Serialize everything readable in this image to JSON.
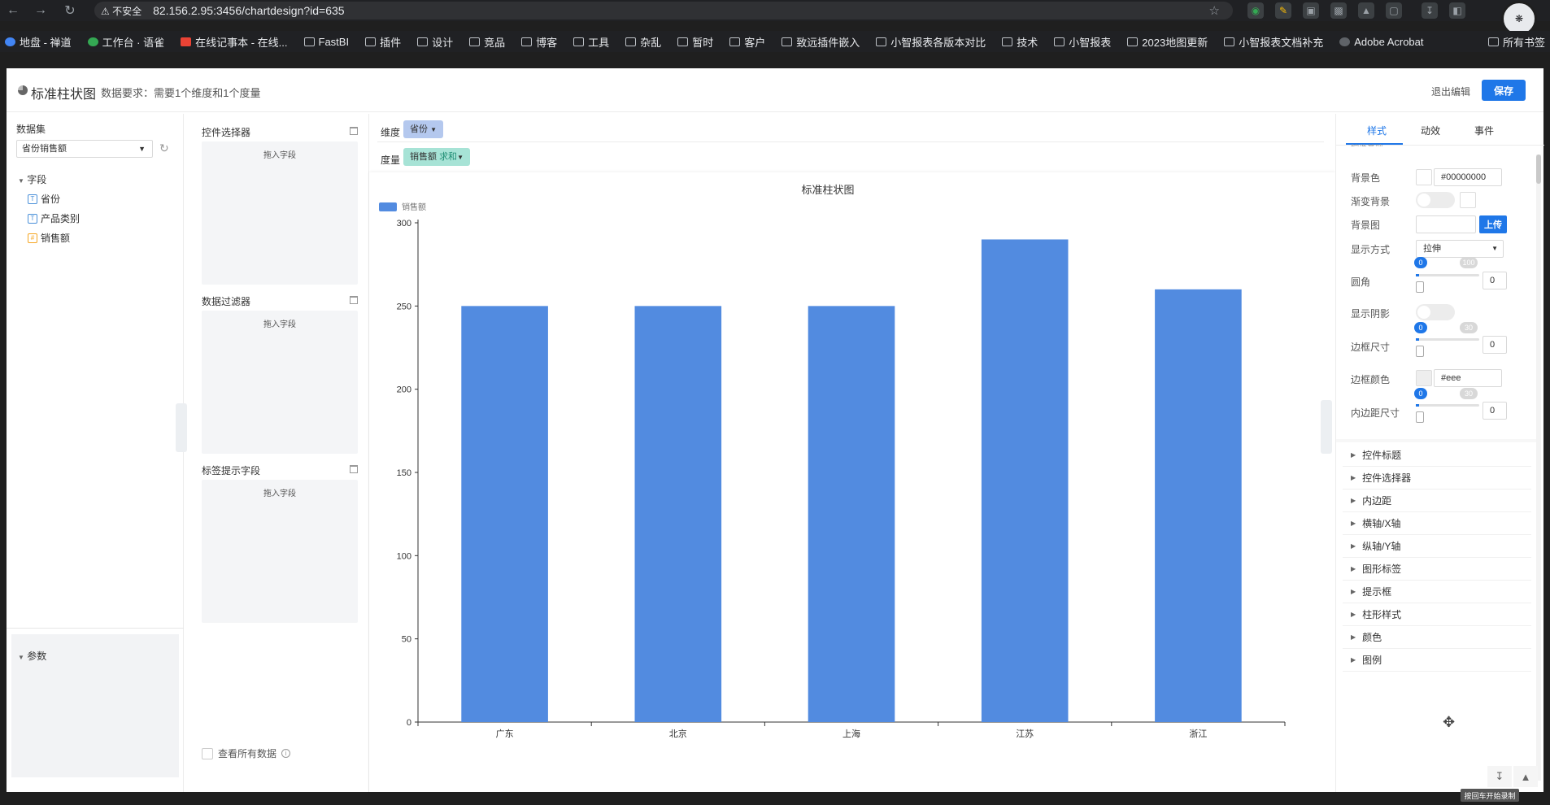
{
  "browser": {
    "security_label": "不安全",
    "url": "82.156.2.95:3456/chartdesign?id=635",
    "bookmarks": [
      "地盘 - 禅道",
      "工作台 · 语雀",
      "在线记事本 - 在线...",
      "FastBI",
      "插件",
      "设计",
      "竞品",
      "博客",
      "工具",
      "杂乱",
      "暂时",
      "客户",
      "致远插件嵌入",
      "小智报表各版本对比",
      "技术",
      "小智报表",
      "2023地图更新",
      "小智报表文档补充",
      "Adobe Acrobat"
    ],
    "bookmarks_right": "所有书签"
  },
  "header": {
    "title": "标准柱状图",
    "requirement": "数据要求：需要1个维度和1个度量",
    "exit_label": "退出编辑",
    "save_label": "保存"
  },
  "dataset": {
    "label": "数据集",
    "selected": "省份销售额",
    "tree_root": "字段",
    "fields": [
      "省份",
      "产品类别",
      "销售额"
    ],
    "params_label": "参数"
  },
  "controls": {
    "selector_label": "控件选择器",
    "filter_label": "数据过滤器",
    "tooltip_label": "标签提示字段",
    "drop_text": "拖入字段",
    "check_all_label": "查看所有数据"
  },
  "fields_bar": {
    "dimension_label": "维度",
    "dimension_chip": "省份",
    "measure_label": "度量",
    "measure_chip": "销售额",
    "measure_agg": "求和"
  },
  "chart_data": {
    "type": "bar",
    "title": "标准柱状图",
    "categories": [
      "广东",
      "北京",
      "上海",
      "江苏",
      "浙江"
    ],
    "series": [
      {
        "name": "销售额",
        "values": [
          250,
          250,
          250,
          290,
          260
        ]
      }
    ],
    "ylim": [
      0,
      300
    ],
    "yticks": [
      0,
      50,
      100,
      150,
      200,
      250,
      300
    ],
    "legend": "top-left",
    "bar_color": "#528be0"
  },
  "style_panel": {
    "tabs": [
      "样式",
      "动效",
      "事件"
    ],
    "clipped_header": "控件基础",
    "bg_color_label": "背景色",
    "bg_color_value": "#00000000",
    "gradient_label": "渐变背景",
    "bg_image_label": "背景图",
    "upload_label": "上传",
    "display_mode_label": "显示方式",
    "display_mode_value": "拉伸",
    "radius_label": "圆角",
    "radius_value": "0",
    "radius_max": "100",
    "shadow_label": "显示阴影",
    "border_size_label": "边框尺寸",
    "border_size_value": "0",
    "border_size_max": "30",
    "border_color_label": "边框颜色",
    "border_color_value": "#eee",
    "padding_label": "内边距尺寸",
    "padding_value": "0",
    "padding_max": "30",
    "sections": [
      "控件标题",
      "控件选择器",
      "内边距",
      "横轴/X轴",
      "纵轴/Y轴",
      "图形标签",
      "提示框",
      "柱形样式",
      "颜色",
      "图例"
    ]
  },
  "bottom_hint": "按回车开始录制"
}
